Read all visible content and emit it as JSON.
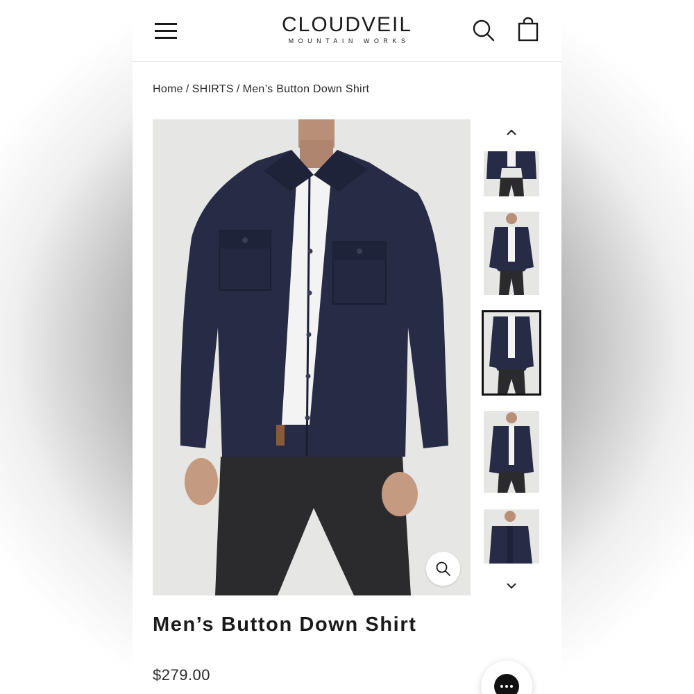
{
  "header": {
    "logo_main": "CLOUDVEIL",
    "logo_sub": "MOUNTAIN WORKS",
    "menu_icon": "hamburger-menu-icon",
    "search_icon": "search-icon",
    "cart_icon": "shopping-bag-icon"
  },
  "breadcrumb": {
    "items": [
      "Home",
      "SHIRTS",
      "Men’s Button Down Shirt"
    ],
    "separator": "/"
  },
  "gallery": {
    "thumbnail_count": 5,
    "active_thumbnail": 3,
    "zoom_icon": "zoom-icon",
    "prev_icon": "chevron-up-icon",
    "next_icon": "chevron-down-icon"
  },
  "product": {
    "title": "Men’s Button Down Shirt",
    "price": "$279.00",
    "color_shirt": "#272b45",
    "color_pants": "#2a2a2c"
  },
  "chat": {
    "icon": "chat-icon"
  }
}
